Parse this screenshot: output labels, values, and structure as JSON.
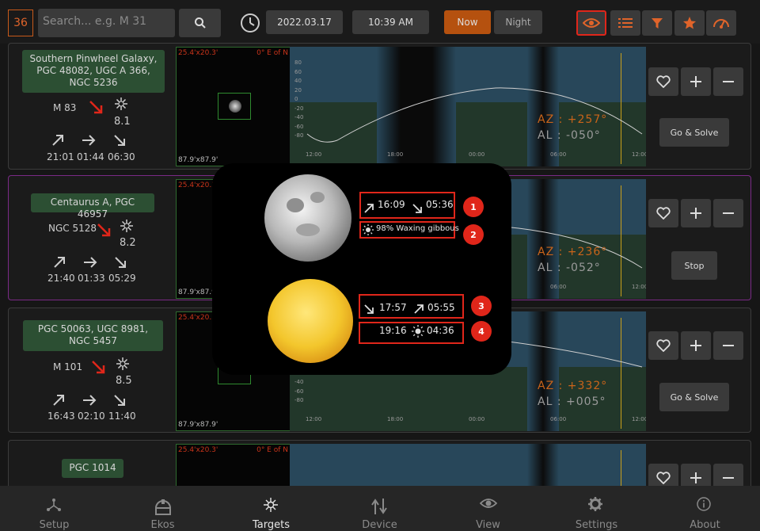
{
  "header": {
    "count": "36",
    "search_placeholder": "Search... e.g. M 31",
    "date": "2022.03.17",
    "time": "10:39 AM",
    "now_label": "Now",
    "night_label": "Night"
  },
  "targets": [
    {
      "name": "Southern Pinwheel Galaxy, PGC 48082, UGC A 366, NGC 5236",
      "id": "M 83",
      "mag": "8.1",
      "rise": "21:01",
      "transit": "01:44",
      "set": "06:30",
      "fov": "25.4'x20.3'",
      "angle": "0° E of N",
      "size": "87.9'x87.9'",
      "az": "AZ : +257°",
      "al": "AL : -050°",
      "action": "Go & Solve"
    },
    {
      "name": "Centaurus A, PGC 46957",
      "id": "NGC 5128",
      "mag": "8.2",
      "rise": "21:40",
      "transit": "01:33",
      "set": "05:29",
      "fov": "25.4'x20.3'",
      "angle": "",
      "size": "87.9'x87.9'",
      "az": "AZ : +236°",
      "al": "AL : -052°",
      "action": "Stop"
    },
    {
      "name": "PGC 50063, UGC 8981, NGC 5457",
      "id": "M 101",
      "mag": "8.5",
      "rise": "16:43",
      "transit": "02:10",
      "set": "11:40",
      "fov": "25.4'x20.3'",
      "angle": "",
      "size": "87.9'x87.9'",
      "az": "AZ : +332°",
      "al": "AL : +005°",
      "action": "Go & Solve"
    },
    {
      "name": "PGC 1014",
      "fov": "25.4'x20.3'",
      "angle": "0° E of N"
    }
  ],
  "graph_axis": {
    "y_ticks": [
      "80",
      "60",
      "40",
      "20",
      "0",
      "-20",
      "-40",
      "-60",
      "-80"
    ],
    "x_ticks": [
      "12:00",
      "18:00",
      "00:00",
      "06:00",
      "12:00"
    ]
  },
  "popup": {
    "moon_rise": "16:09",
    "moon_set": "05:36",
    "moon_phase": "98% Waxing gibbous",
    "sun_set": "17:57",
    "sun_rise": "05:55",
    "dusk": "19:16",
    "dawn": "04:36",
    "badges": [
      "1",
      "2",
      "3",
      "4"
    ]
  },
  "nav": [
    {
      "label": "Setup",
      "icon": "setup-icon"
    },
    {
      "label": "Ekos",
      "icon": "ekos-icon"
    },
    {
      "label": "Targets",
      "icon": "targets-icon",
      "active": true
    },
    {
      "label": "Device",
      "icon": "device-icon"
    },
    {
      "label": "View",
      "icon": "view-icon"
    },
    {
      "label": "Settings",
      "icon": "settings-icon"
    },
    {
      "label": "About",
      "icon": "about-icon"
    }
  ],
  "colors": {
    "accent": "#e0642a",
    "highlight": "#e0261a",
    "name_bg": "#2c4f33"
  }
}
